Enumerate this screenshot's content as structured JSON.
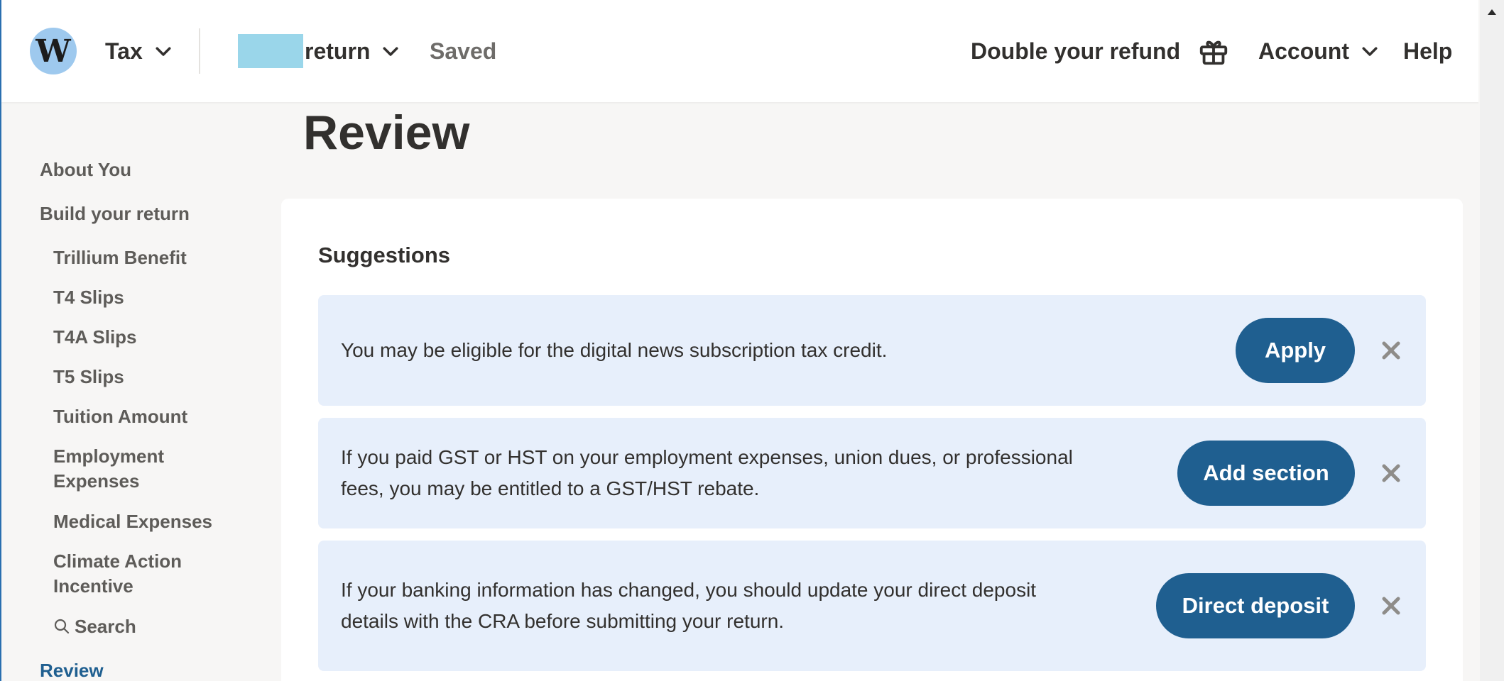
{
  "header": {
    "logo_letter": "W",
    "tax_label": "Tax",
    "return_label": "return",
    "saved_label": "Saved",
    "refund_label": "Double your refund",
    "account_label": "Account",
    "help_label": "Help"
  },
  "sidebar": {
    "about_you": "About You",
    "build_return": "Build your return",
    "items": [
      "Trillium Benefit",
      "T4 Slips",
      "T4A Slips",
      "T5 Slips",
      "Tuition Amount",
      "Employment",
      "Expenses",
      "Medical Expenses",
      "Climate Action",
      "Incentive"
    ],
    "search_label": "Search",
    "review_label": "Review"
  },
  "main": {
    "title": "Review",
    "card_title": "Suggestions",
    "suggestions": [
      {
        "line1": "You may be eligible for the digital news subscription tax credit.",
        "button": "Apply"
      },
      {
        "line1": "If you paid GST or HST on your employment expenses, union dues, or professional",
        "line2": "fees, you may be entitled to a GST/HST rebate.",
        "button": "Add section"
      },
      {
        "line1": "If your banking information has changed, you should update your direct deposit",
        "line2": "details with the CRA before submitting your return.",
        "button": "Direct deposit"
      }
    ]
  },
  "colors": {
    "accent": "#1f5f90",
    "suggestion_bg": "#e7effb",
    "page_bg": "#f7f6f5",
    "logo_bg": "#9ec9ee"
  },
  "icons": {
    "gift": "gift-icon",
    "chevron": "chevron-down-icon",
    "close": "close-icon",
    "search": "search-icon"
  }
}
